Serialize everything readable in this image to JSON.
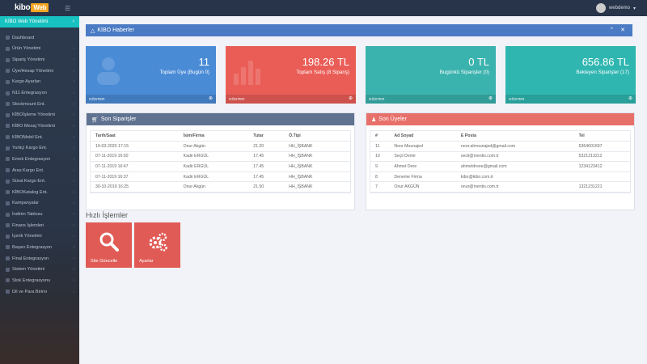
{
  "topbar": {
    "logo_text": "kibo",
    "logo_badge": "Web",
    "username": "webdemo"
  },
  "sidebar": {
    "header": "KİBO Web Yönetimi",
    "items": [
      {
        "label": "Dashboard"
      },
      {
        "label": "Ürün Yönetimi"
      },
      {
        "label": "Sipariş Yönetimi"
      },
      {
        "label": "Üye/Hesap Yönetimi"
      },
      {
        "label": "Kargo Ayarları"
      },
      {
        "label": "N11 Entegrasyon"
      },
      {
        "label": "Stockmount Ent."
      },
      {
        "label": "KİBOİşleme Yönetimi"
      },
      {
        "label": "KİBO Mesaj Yönetimi"
      },
      {
        "label": "KİBOMobil Ent."
      },
      {
        "label": "Yurtiçi Kargo Ent."
      },
      {
        "label": "Emek Entegrasyon"
      },
      {
        "label": "Aras Kargo Ent."
      },
      {
        "label": "Sürat Kargo Ent."
      },
      {
        "label": "KİBOKatalog Ent."
      },
      {
        "label": "Kampanyalar"
      },
      {
        "label": "İndirim Tablosu"
      },
      {
        "label": "Finans İşlemleri"
      },
      {
        "label": "İçerik Yönetimi"
      },
      {
        "label": "Başarı Entegrasyon"
      },
      {
        "label": "Final Entegrasyon"
      },
      {
        "label": "Sistem Yönetimi"
      },
      {
        "label": "Stok Entegrasyonu"
      },
      {
        "label": "Dil ve Para Birimi"
      }
    ]
  },
  "news": {
    "title": "KİBO Haberler",
    "tools": "⌃ ✕"
  },
  "stats": [
    {
      "value": "11",
      "label": "Toplam Üye (Bugün 0)",
      "footer": "GÖSTER",
      "color": "#4a8bd6"
    },
    {
      "value": "198.26 TL",
      "label": "Toplam Satış (8 Sipariş)",
      "footer": "GÖSTER",
      "color": "#ea5d57"
    },
    {
      "value": "0 TL",
      "label": "Bugünkü Siparişler (0)",
      "footer": "GÖSTER",
      "color": "#3ab2ad"
    },
    {
      "value": "656.86 TL",
      "label": "Bekleyen Siparişler (17)",
      "footer": "GÖSTER",
      "color": "#2fb6b0"
    }
  ],
  "orders": {
    "title": "Son Siparişler",
    "columns": [
      "Tarih/Saat",
      "İsim/Firma",
      "Tutar",
      "Ö.Tipi"
    ],
    "rows": [
      [
        "19-03-2020 17:15",
        "Onur Akgün",
        "21.20",
        "HH_İŞBANK"
      ],
      [
        "07-11-2019 16:50",
        "Kadir ERGÜL",
        "17.45",
        "HH_İŞBANK"
      ],
      [
        "07-11-2019 16:47",
        "Kadir ERGÜL",
        "17.45",
        "HH_İŞBANK"
      ],
      [
        "07-11-2019 16:37",
        "Kadir ERGÜL",
        "17.45",
        "HH_İŞBANK"
      ],
      [
        "30-10-2019 16:25",
        "Onur Akgün",
        "21.50",
        "HH_İŞBANK"
      ]
    ]
  },
  "members": {
    "title": "Son Üyeler",
    "columns": [
      "#",
      "Ad Soyad",
      "E Posta",
      "Tel"
    ],
    "rows": [
      [
        "11",
        "Noor Mounajed",
        "noor.almounajed@gmail.com",
        "5364601697"
      ],
      [
        "10",
        "Seçil Demir",
        "secil@mentis.com.tr",
        "5321313212"
      ],
      [
        "9",
        "Ahmet Dere",
        "ahmetdreee@gmail.com",
        "1234123412"
      ],
      [
        "8",
        "Deneme Firma",
        "kibo@kibo.com.tr",
        ""
      ],
      [
        "7",
        "Onur AKGÜN",
        "onur@mentis.com.tr",
        "1321231221"
      ]
    ]
  },
  "quick": {
    "title": "Hızlı İşlemler",
    "buttons": [
      {
        "label": "Site Güncelle"
      },
      {
        "label": "Ayarlar"
      }
    ]
  }
}
